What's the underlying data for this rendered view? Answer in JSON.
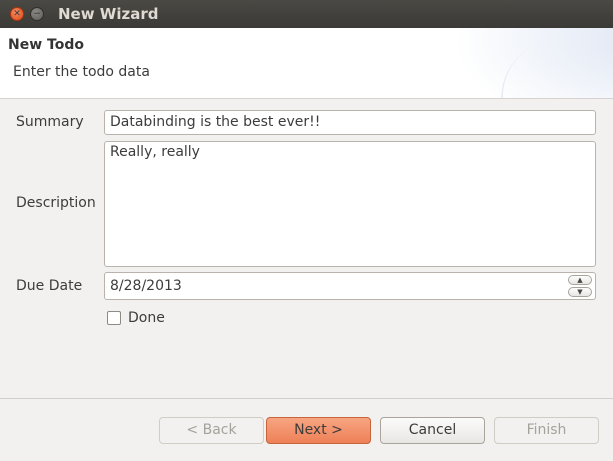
{
  "window": {
    "title": "New Wizard"
  },
  "header": {
    "title": "New Todo",
    "description": "Enter the todo data"
  },
  "form": {
    "summary_label": "Summary",
    "summary_value": "Databinding is the best ever!!",
    "description_label": "Description",
    "description_value": "Really, really",
    "due_date_label": "Due Date",
    "due_date_value": "8/28/2013",
    "done_label": "Done",
    "done_checked": false
  },
  "buttons": {
    "back": "< Back",
    "next": "Next >",
    "cancel": "Cancel",
    "finish": "Finish"
  },
  "colors": {
    "accent_button": "#ee8057",
    "titlebar": "#3b3a36",
    "close_button": "#df4b16"
  }
}
